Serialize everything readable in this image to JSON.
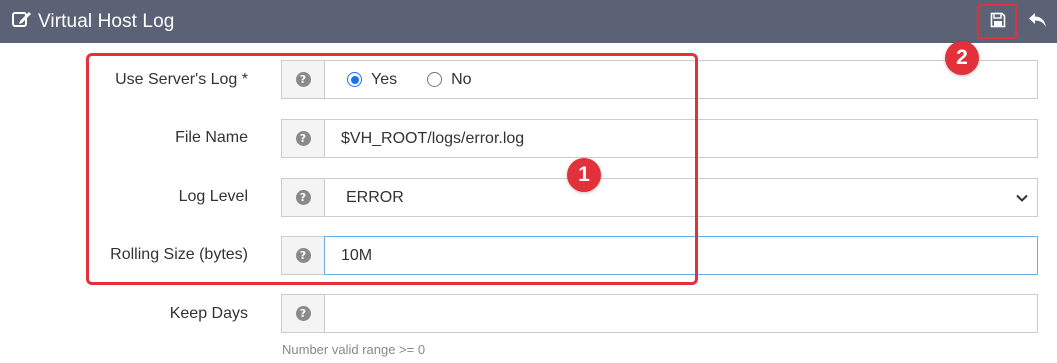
{
  "header": {
    "title": "Virtual Host Log",
    "edit_icon": "edit-icon",
    "save_icon": "save-icon",
    "undo_icon": "undo-icon",
    "background": "#5b6276"
  },
  "form": {
    "use_server_log": {
      "label": "Use Server's Log *",
      "options": [
        {
          "label": "Yes",
          "checked": true
        },
        {
          "label": "No",
          "checked": false
        }
      ]
    },
    "file_name": {
      "label": "File Name",
      "value": "$VH_ROOT/logs/error.log"
    },
    "log_level": {
      "label": "Log Level",
      "value": "ERROR"
    },
    "rolling_size": {
      "label": "Rolling Size (bytes)",
      "value": "10M"
    },
    "keep_days": {
      "label": "Keep Days",
      "value": "",
      "hint": "Number valid range >= 0"
    },
    "help_glyph": "?"
  },
  "callouts": {
    "badge_1": "1",
    "badge_2": "2",
    "color": "#e2313a"
  }
}
